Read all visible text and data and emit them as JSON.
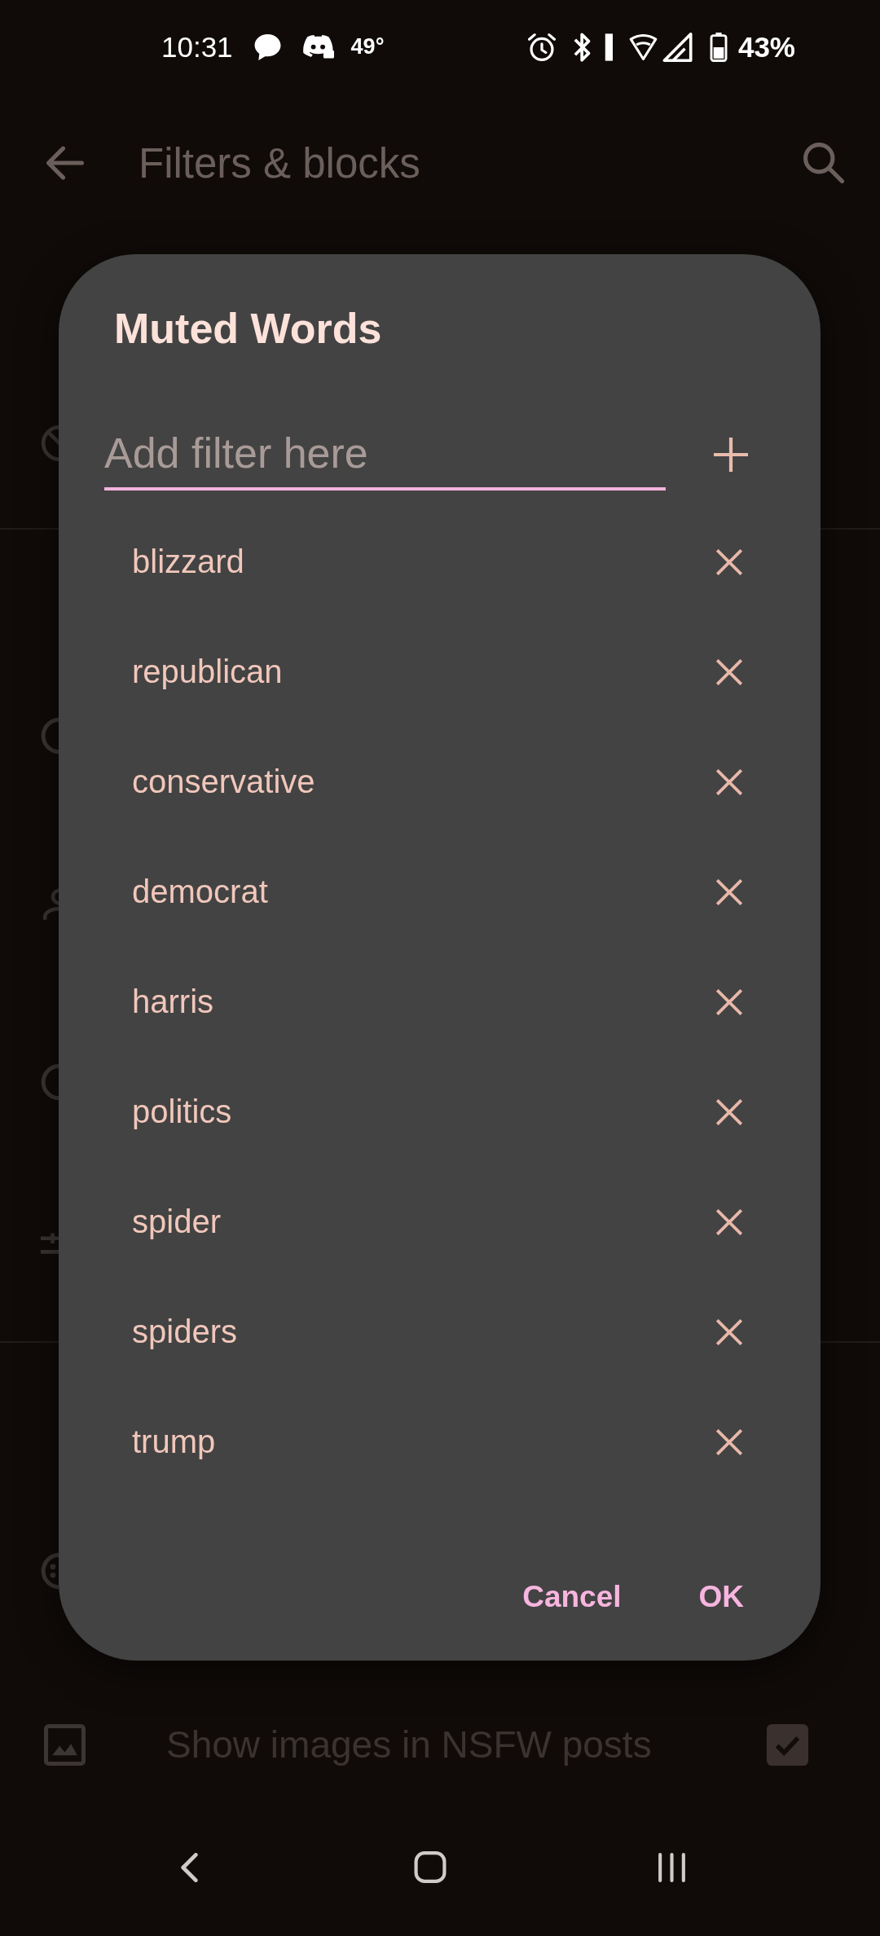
{
  "status_bar": {
    "time": "10:31",
    "temperature": "49°",
    "battery": "43%"
  },
  "app_bar": {
    "title": "Filters & blocks"
  },
  "dialog": {
    "title": "Muted Words",
    "input": {
      "placeholder": "Add filter here",
      "focused": true
    },
    "words": [
      "blizzard",
      "republican",
      "conservative",
      "democrat",
      "harris",
      "politics",
      "spider",
      "spiders",
      "trump"
    ],
    "buttons": [
      "Cancel",
      "OK"
    ]
  },
  "background_setting": {
    "label": "Show images in NSFW posts",
    "checked": true
  }
}
